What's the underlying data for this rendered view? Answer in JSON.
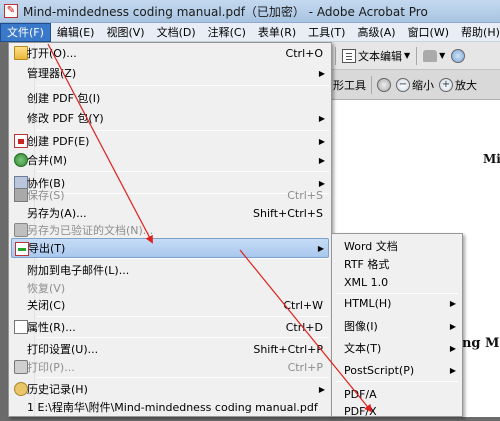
{
  "window": {
    "app_icon": "pdf-app-icon",
    "title": "Mind-mindedness coding manual.pdf（已加密） - Adobe Acrobat Pro"
  },
  "menubar": {
    "items": [
      {
        "label": "文件(F)",
        "active": true
      },
      {
        "label": "编辑(E)"
      },
      {
        "label": "视图(V)"
      },
      {
        "label": "文档(D)"
      },
      {
        "label": "注释(C)"
      },
      {
        "label": "表单(R)"
      },
      {
        "label": "工具(T)"
      },
      {
        "label": "高级(A)"
      },
      {
        "label": "窗口(W)"
      },
      {
        "label": "帮助(H)"
      }
    ]
  },
  "toolbar": {
    "text_edit_label": "文本编辑",
    "rect_tool_label": "形工具",
    "zoom_out_label": "缩小",
    "zoom_in_label": "放大"
  },
  "document": {
    "fragment_1": "Mi",
    "fragment_2": "ing Ma"
  },
  "file_menu": {
    "items": [
      {
        "label": "打开(O)...",
        "shortcut": "Ctrl+O",
        "icon": "folder-icon"
      },
      {
        "label": "管理器(Z)",
        "submenu": true
      },
      {
        "label": "创建 PDF 包(I)"
      },
      {
        "label": "修改 PDF 包(Y)",
        "submenu": true
      },
      {
        "label": "创建 PDF(E)",
        "submenu": true,
        "icon": "create-pdf-icon"
      },
      {
        "label": "合并(M)",
        "submenu": true,
        "icon": "merge-icon"
      },
      {
        "label": "协作(B)",
        "submenu": true,
        "icon": "collaborate-icon"
      },
      {
        "label": "保存(S)",
        "shortcut": "Ctrl+S",
        "disabled": true,
        "icon": "save-icon"
      },
      {
        "label": "另存为(A)...",
        "shortcut": "Shift+Ctrl+S"
      },
      {
        "label": "另存为已验证的文档(N)...",
        "disabled": true,
        "icon": "certified-doc-icon"
      },
      {
        "label": "导出(T)",
        "submenu": true,
        "highlighted": true,
        "icon": "export-icon"
      },
      {
        "label": "附加到电子邮件(L)..."
      },
      {
        "label": "恢复(V)",
        "disabled": true
      },
      {
        "label": "关闭(C)",
        "shortcut": "Ctrl+W"
      },
      {
        "label": "属性(R)...",
        "shortcut": "Ctrl+D",
        "icon": "properties-icon"
      },
      {
        "label": "打印设置(U)...",
        "shortcut": "Shift+Ctrl+P"
      },
      {
        "label": "打印(P)...",
        "shortcut": "Ctrl+P",
        "disabled": true,
        "icon": "printer-icon"
      },
      {
        "label": "历史记录(H)",
        "submenu": true,
        "icon": "history-icon"
      },
      {
        "label": "1 E:\\程南华\\附件\\Mind-mindedness coding manual.pdf"
      }
    ]
  },
  "export_submenu": {
    "items": [
      {
        "label": "Word 文档"
      },
      {
        "label": "RTF 格式"
      },
      {
        "label": "XML 1.0"
      },
      {
        "label": "HTML(H)",
        "submenu": true
      },
      {
        "label": "图像(I)",
        "submenu": true
      },
      {
        "label": "文本(T)",
        "submenu": true
      },
      {
        "label": "PostScript(P)",
        "submenu": true
      },
      {
        "label": "PDF/A"
      },
      {
        "label": "PDF/X"
      }
    ]
  },
  "colors": {
    "menu_highlight": "#a9c8ee",
    "annotation_arrow": "#e0201c",
    "active_menu": "#3a78c9"
  }
}
